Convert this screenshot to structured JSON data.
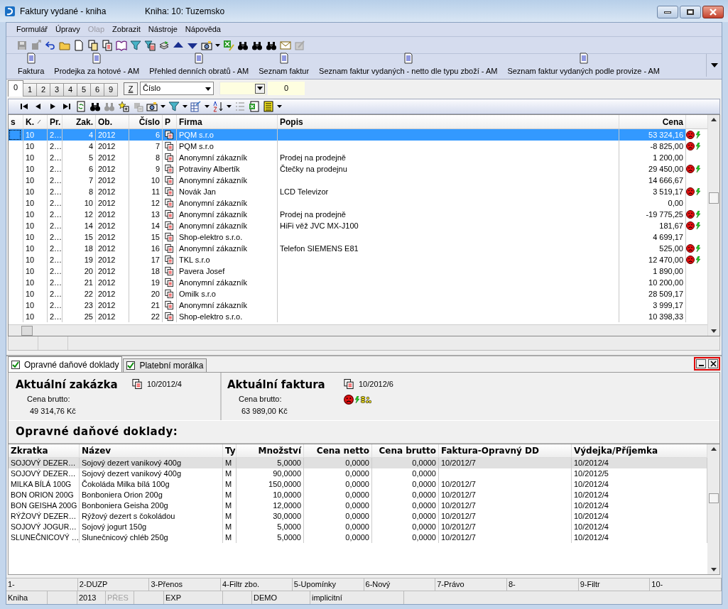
{
  "window": {
    "title": "Faktury vydané - kniha",
    "subtitle": "Kniha: 10: Tuzemsko"
  },
  "menu": [
    {
      "label": "Formulář",
      "disabled": false
    },
    {
      "label": "Úpravy",
      "disabled": false
    },
    {
      "label": "Olap",
      "disabled": true
    },
    {
      "label": "Zobrazit",
      "disabled": false
    },
    {
      "label": "Nástroje",
      "disabled": false
    },
    {
      "label": "Nápověda",
      "disabled": false
    }
  ],
  "reports": [
    "Faktura",
    "Prodejka za hotové - AM",
    "Přehled denních obratů - AM",
    "Seznam faktur",
    "Seznam faktur vydaných - netto dle typu zboží - AM",
    "Seznam faktur vydaných podle provize - AM"
  ],
  "view_tabs": [
    {
      "label": "0",
      "selected": true
    },
    {
      "label": "1",
      "selected": false
    },
    {
      "label": "2",
      "selected": false
    },
    {
      "label": "3",
      "selected": false
    },
    {
      "label": "4",
      "selected": false
    },
    {
      "label": "5",
      "selected": false
    },
    {
      "label": "6",
      "selected": false
    },
    {
      "label": "9",
      "selected": false
    }
  ],
  "sort_button": "Z",
  "sort_select": {
    "value": "Číslo"
  },
  "count_field": {
    "value": "0"
  },
  "table": {
    "columns": [
      "s",
      "K.",
      "Pr.",
      "Zak.",
      "Ob.",
      "Číslo",
      "P",
      "Firma",
      "Popis",
      "Cena"
    ],
    "rows": [
      {
        "k": "10",
        "pr": "2…",
        "zak": "4",
        "ob": "2012",
        "cislo": "6",
        "firma": "PQM s.r.o",
        "cena": "53 324,16",
        "flags": true,
        "selected": true
      },
      {
        "k": "10",
        "pr": "2…",
        "zak": "4",
        "ob": "2012",
        "cislo": "7",
        "firma": "PQM s.r.o",
        "cena": "-8 825,00",
        "flags": true,
        "selected": false
      },
      {
        "k": "10",
        "pr": "2…",
        "zak": "5",
        "ob": "2012",
        "cislo": "8",
        "firma": "Anonymní zákazník",
        "popis": "Prodej na prodejně",
        "cena": "1 200,00",
        "flags": false,
        "selected": false
      },
      {
        "k": "10",
        "pr": "2…",
        "zak": "6",
        "ob": "2012",
        "cislo": "9",
        "firma": "Potraviny Albertík",
        "popis": "Čtečky na prodejnu",
        "cena": "29 450,00",
        "flags": true,
        "selected": false
      },
      {
        "k": "10",
        "pr": "2…",
        "zak": "7",
        "ob": "2012",
        "cislo": "10",
        "firma": "Anonymní zákazník",
        "cena": "14 666,67",
        "flags": false,
        "selected": false
      },
      {
        "k": "10",
        "pr": "2…",
        "zak": "8",
        "ob": "2012",
        "cislo": "11",
        "firma": "Novák Jan",
        "popis": "LCD Televizor",
        "cena": "3 519,17",
        "flags": true,
        "selected": false
      },
      {
        "k": "10",
        "pr": "2…",
        "zak": "10",
        "ob": "2012",
        "cislo": "12",
        "firma": "Anonymní zákazník",
        "cena": "0,00",
        "flags": false,
        "selected": false
      },
      {
        "k": "10",
        "pr": "2…",
        "zak": "12",
        "ob": "2012",
        "cislo": "13",
        "firma": "Anonymní zákazník",
        "popis": "Prodej na prodejně",
        "cena": "-19 775,25",
        "flags": true,
        "selected": false
      },
      {
        "k": "10",
        "pr": "2…",
        "zak": "14",
        "ob": "2012",
        "cislo": "14",
        "firma": "Anonymní zákazník",
        "popis": "HiFi věž JVC MX-J100",
        "cena": "181,67",
        "flags": true,
        "selected": false
      },
      {
        "k": "10",
        "pr": "2…",
        "zak": "15",
        "ob": "2012",
        "cislo": "15",
        "firma": "Shop-elektro s.r.o.",
        "cena": "4 699,17",
        "flags": false,
        "selected": false
      },
      {
        "k": "10",
        "pr": "2…",
        "zak": "18",
        "ob": "2012",
        "cislo": "16",
        "firma": "Anonymní zákazník",
        "popis": "Telefon SIEMENS E81",
        "cena": "525,00",
        "flags": true,
        "selected": false
      },
      {
        "k": "10",
        "pr": "2…",
        "zak": "19",
        "ob": "2012",
        "cislo": "17",
        "firma": "TKL s.r.o",
        "cena": "12 470,00",
        "flags": true,
        "selected": false
      },
      {
        "k": "10",
        "pr": "2…",
        "zak": "20",
        "ob": "2012",
        "cislo": "18",
        "firma": "Pavera Josef",
        "cena": "1 890,00",
        "flags": false,
        "selected": false
      },
      {
        "k": "10",
        "pr": "2…",
        "zak": "21",
        "ob": "2012",
        "cislo": "19",
        "firma": "Anonymní zákazník",
        "cena": "10 200,00",
        "flags": false,
        "selected": false
      },
      {
        "k": "10",
        "pr": "2…",
        "zak": "22",
        "ob": "2012",
        "cislo": "20",
        "firma": "Omilk s.r.o",
        "cena": "28 509,17",
        "flags": false,
        "selected": false
      },
      {
        "k": "10",
        "pr": "2…",
        "zak": "23",
        "ob": "2012",
        "cislo": "21",
        "firma": "Anonymní zákazník",
        "cena": "3 999,17",
        "flags": false,
        "selected": false
      },
      {
        "k": "10",
        "pr": "2…",
        "zak": "25",
        "ob": "2012",
        "cislo": "22",
        "firma": "Shop-elektro s.r.o.",
        "cena": "10 398,33",
        "flags": false,
        "selected": false
      }
    ]
  },
  "detail_tabs": [
    {
      "label": "Opravné daňové doklady",
      "checked": true,
      "selected": true
    },
    {
      "label": "Platební morálka",
      "checked": true,
      "selected": false
    }
  ],
  "order": {
    "title": "Aktuální zakázka",
    "doc": "10/2012/4",
    "price_label": "Cena brutto:",
    "price": "49 314,76 Kč"
  },
  "invoice": {
    "title": "Aktuální faktura",
    "doc": "10/2012/6",
    "price_label": "Cena brutto:",
    "price": "63 989,00 Kč",
    "flags": true
  },
  "corrections": {
    "heading": "Opravné daňové doklady:",
    "columns": [
      "Zkratka",
      "Název",
      "Ty",
      "Množství",
      "Cena netto",
      "Cena brutto",
      "Faktura-Opravný DD",
      "Výdejka/Příjemka"
    ],
    "rows": [
      {
        "zkratka": "SOJOVÝ DEZER…",
        "nazev": "Sojový dezert vanikový 400g",
        "ty": "M",
        "mnozstvi": "5,0000",
        "netto": "0,0000",
        "brutto": "0,0000",
        "faktura": "10/2012/7",
        "vydejka": "10/2012/4",
        "selected": true
      },
      {
        "zkratka": "SOJOVÝ DEZER…",
        "nazev": "Sojový dezert vanikový 400g",
        "ty": "M",
        "mnozstvi": "90,0000",
        "netto": "0,0000",
        "brutto": "0,0000",
        "vydejka": "10/2012/5",
        "selected": false
      },
      {
        "zkratka": "MILKA BÍLÁ 100G",
        "nazev": "Čokoláda Milka bílá 100g",
        "ty": "M",
        "mnozstvi": "150,0000",
        "netto": "0,0000",
        "brutto": "0,0000",
        "faktura": "10/2012/7",
        "vydejka": "10/2012/4",
        "selected": false
      },
      {
        "zkratka": "BON ORION 200G",
        "nazev": "Bonboniera Orion 200g",
        "ty": "M",
        "mnozstvi": "10,0000",
        "netto": "0,0000",
        "brutto": "0,0000",
        "faktura": "10/2012/7",
        "vydejka": "10/2012/4",
        "selected": false
      },
      {
        "zkratka": "BON GEISHA 200G",
        "nazev": "Bonboniera Geisha 200g",
        "ty": "M",
        "mnozstvi": "12,0000",
        "netto": "0,0000",
        "brutto": "0,0000",
        "faktura": "10/2012/7",
        "vydejka": "10/2012/4",
        "selected": false
      },
      {
        "zkratka": "RÝŽOVÝ DEZER…",
        "nazev": "Rýžový dezert s čokoládou",
        "ty": "M",
        "mnozstvi": "30,0000",
        "netto": "0,0000",
        "brutto": "0,0000",
        "faktura": "10/2012/7",
        "vydejka": "10/2012/4",
        "selected": false
      },
      {
        "zkratka": "SOJOVÝ JOGUR…",
        "nazev": "Sojový jogurt 150g",
        "ty": "M",
        "mnozstvi": "5,0000",
        "netto": "0,0000",
        "brutto": "0,0000",
        "faktura": "10/2012/7",
        "vydejka": "10/2012/4",
        "selected": false
      },
      {
        "zkratka": "SLUNEČNICOVÝ …",
        "nazev": "Slunečnicový chléb 250g",
        "ty": "M",
        "mnozstvi": "5,0000",
        "netto": "0,0000",
        "brutto": "0,0000",
        "faktura": "10/2012/7",
        "vydejka": "10/2012/4",
        "selected": false
      }
    ]
  },
  "function_keys": [
    "1-",
    "2-DUZP",
    "3-Přenos",
    "4-Filtr zbo.",
    "5-Upomínky",
    "6-Nový",
    "7-Právo",
    "8-",
    "9-Filtr",
    "10-"
  ],
  "status_bar": [
    {
      "text": "Kniha",
      "disabled": false
    },
    {
      "text": "2013",
      "disabled": false
    },
    {
      "text": "PŘES",
      "disabled": true
    },
    {
      "text": "EXP",
      "disabled": false
    },
    {
      "text": "DEMO",
      "disabled": false
    },
    {
      "text": "implicitní",
      "disabled": false
    }
  ]
}
